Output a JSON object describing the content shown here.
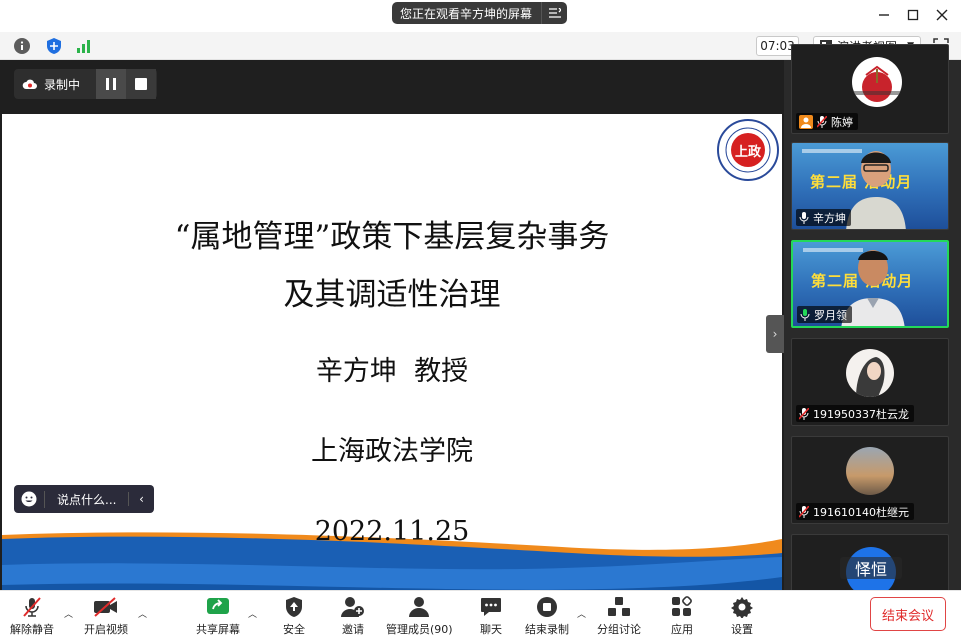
{
  "title_bar": {
    "sharing_text": "您正在观看辛方坤的屏幕",
    "menu_icon": "list-icon",
    "controls": [
      "minimize-icon",
      "maximize-icon",
      "close-icon"
    ]
  },
  "info_bar": {
    "time": "07:03",
    "view_mode": "演讲者视图",
    "icons": [
      "info-icon",
      "shield-icon",
      "signal-icon",
      "fullscreen-icon"
    ]
  },
  "recording": {
    "label": "录制中"
  },
  "slide": {
    "title_line1": "“属地管理”政策下基层复杂事务",
    "title_line2": "及其调适性治理",
    "presenter": "辛方坤  教授",
    "institution": "上海政法学院",
    "date": "2022.11.25",
    "logo_text": "上政"
  },
  "chat_prompt": {
    "placeholder": "说点什么..."
  },
  "participants": [
    {
      "name": "陈婷",
      "muted": true
    },
    {
      "name": "辛方坤",
      "muted": false,
      "banner": "第二届    活动月"
    },
    {
      "name": "罗月领",
      "muted": false,
      "active": true,
      "banner": "第二届    活动月"
    },
    {
      "name": "191950337杜云龙",
      "muted": true
    },
    {
      "name": "191610140杜继元",
      "muted": true
    },
    {
      "name": "怿恒",
      "muted": true
    }
  ],
  "toolbar": {
    "unmute": "解除静音",
    "start_video": "开启视频",
    "share_screen": "共享屏幕",
    "security": "安全",
    "invite": "邀请",
    "participants": "管理成员(90)",
    "chat": "聊天",
    "stop_recording": "结束录制",
    "breakout": "分组讨论",
    "apps": "应用",
    "settings": "设置",
    "end_meeting": "结束会议"
  },
  "colors": {
    "active_speaker": "#23d959",
    "end_red": "#e02b2b",
    "dark_bg": "#1f1f1f",
    "slide_blue": "#1a5fb4",
    "slide_orange": "#f08a1c"
  }
}
